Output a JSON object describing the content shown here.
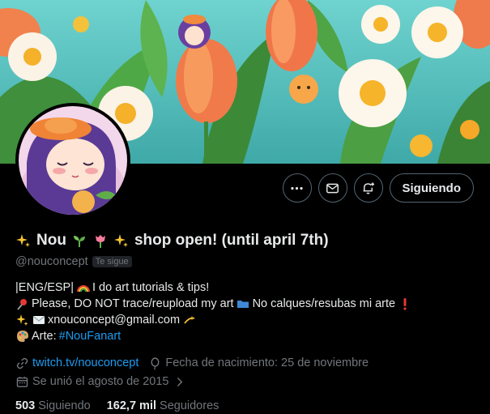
{
  "profile": {
    "display_name": "Nou",
    "display_name_suffix": "shop open! (until april 7th)",
    "handle": "@nouconcept",
    "follows_you_badge": "Te sigue"
  },
  "actions": {
    "more_icon": "more-icon",
    "message_icon": "mail-icon",
    "notify_icon": "bell-plus-icon",
    "follow_label": "Siguiendo"
  },
  "bio": {
    "line1": "|ENG/ESP|",
    "line1b": "I do art tutorials & tips!",
    "line2a": "Please, DO NOT trace/reupload my art",
    "line2b": "No calques/resubas mi arte",
    "line3": "xnouconcept@gmail.com",
    "line4_label": "Arte:",
    "line4_tag": "#NouFanart"
  },
  "meta": {
    "link": "twitch.tv/nouconcept",
    "birthday": "Fecha de nacimiento: 25 de noviembre",
    "joined": "Se unió el agosto de 2015"
  },
  "stats": {
    "following_count": "503",
    "following_label": "Siguiendo",
    "followers_count": "162,7 mil",
    "followers_label": "Seguidores"
  },
  "colors": {
    "accent_blue": "#1d9bf0",
    "muted": "#71767b",
    "text": "#e7e9ea",
    "background": "#000000"
  }
}
